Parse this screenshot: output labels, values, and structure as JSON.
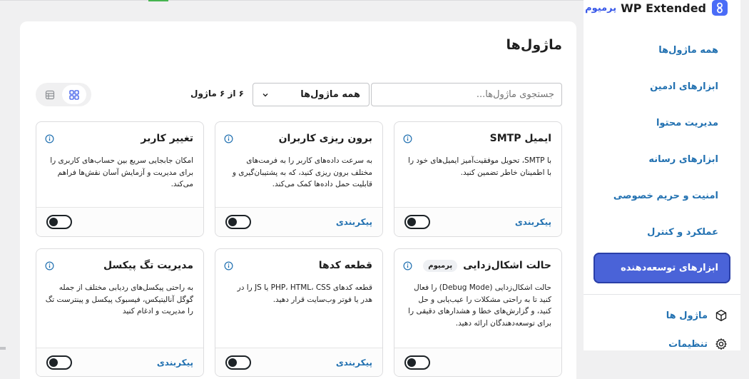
{
  "brand": {
    "name": "WP Extended",
    "badge": "پرمیوم"
  },
  "sidebar": {
    "items": [
      {
        "label": "همه ماژول‌ها",
        "active": false
      },
      {
        "label": "ابزارهای ادمین",
        "active": false
      },
      {
        "label": "مدیریت محتوا",
        "active": false
      },
      {
        "label": "ابزارهای رسانه",
        "active": false
      },
      {
        "label": "امنیت و حریم خصوصی",
        "active": false
      },
      {
        "label": "عملکرد و کنترل",
        "active": false
      },
      {
        "label": "ابزارهای توسعه‌دهنده",
        "active": true
      }
    ],
    "footer": [
      {
        "label": "ماژول ها",
        "icon": "cube-icon"
      },
      {
        "label": "تنظیمات",
        "icon": "gear-icon"
      }
    ]
  },
  "main": {
    "title": "ماژول‌ها",
    "search_placeholder": "جستجوی ماژول‌ها...",
    "filter_value": "همه ماژول‌ها",
    "count": "۶ از ۶ ماژول",
    "view_modes": [
      "grid-icon",
      "list-icon"
    ],
    "active_view": "grid"
  },
  "cards": [
    {
      "title": "ایمیل SMTP",
      "badge": "",
      "description": "با SMTP، تحویل موفقیت‌آمیز ایمیل‌های خود را با اطمینان خاطر تضمین کنید.",
      "config": "پیکربندی",
      "enabled": false
    },
    {
      "title": "برون ریزی کاربران",
      "badge": "",
      "description": "به سرعت داده‌های کاربر را به فرمت‌های مختلف برون ریزی کنید، که به پشتیبان‌گیری و قابلیت حمل داده‌ها کمک می‌کند.",
      "config": "پیکربندی",
      "enabled": false
    },
    {
      "title": "تغییر کاربر",
      "badge": "",
      "description": "امکان جابجایی سریع بین حساب‌های کاربری را برای مدیریت و آزمایش آسان نقش‌ها فراهم می‌کند.",
      "config": "",
      "enabled": false
    },
    {
      "title": "حالت اشکال‌زدایی",
      "badge": "پرمیوم",
      "description": "حالت اشکال‌زدایی (Debug Mode) را فعال کنید تا به راحتی مشکلات را عیب‌یابی و حل کنید، و گزارش‌های خطا و هشدارهای دقیقی را برای توسعه‌دهندگان ارائه دهید.",
      "config": "",
      "enabled": false
    },
    {
      "title": "قطعه کدها",
      "badge": "",
      "description": "قطعه کدهای PHP، HTML، CSS یا JS را در هدر یا فوتر وب‌سایت قرار دهید.",
      "config": "پیکربندی",
      "enabled": false
    },
    {
      "title": "مدیریت تگ پیکسل",
      "badge": "",
      "description": "به راحتی پیکسل‌های ردیابی مختلف از جمله گوگل آنالیتیکس، فیسبوک پیکسل و پینترست تگ را مدیریت و ادغام کنید",
      "config": "پیکربندی",
      "enabled": false
    }
  ],
  "colors": {
    "accent": "#4a63d8",
    "link": "#2271b1",
    "brand": "#4a6cf7"
  }
}
